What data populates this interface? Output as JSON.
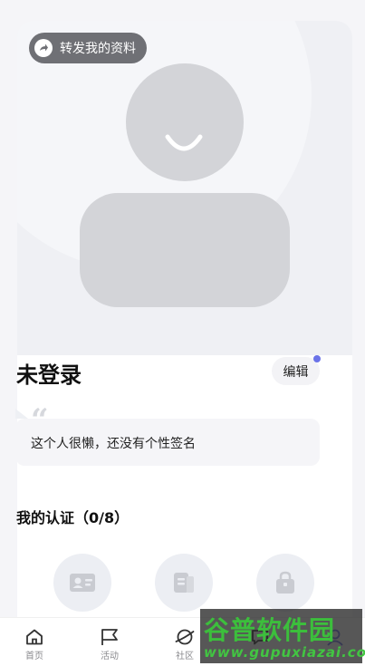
{
  "profile": {
    "share_label": "转发我的资料",
    "name": "未登录",
    "edit_label": "编辑",
    "quote_mark": "“",
    "signature": "这个人很懒，还没有个性签名"
  },
  "certification": {
    "title": "我的认证（0/8）",
    "icons": [
      "id-card-icon",
      "document-icon",
      "bag-icon"
    ]
  },
  "tabbar": {
    "items": [
      {
        "label": "首页",
        "icon": "home-icon"
      },
      {
        "label": "活动",
        "icon": "flag-icon"
      },
      {
        "label": "社区",
        "icon": "planet-icon"
      },
      {
        "label": "",
        "icon": "message-icon"
      },
      {
        "label": "",
        "icon": "profile-icon"
      }
    ]
  },
  "watermark": {
    "title": "谷普软件园",
    "url": "www.gupuxiazai.com"
  },
  "colors": {
    "accent_dot": "#6b73e8",
    "avatar_gray": "#d3d4d8",
    "watermark_green": "#3cbf3c"
  }
}
